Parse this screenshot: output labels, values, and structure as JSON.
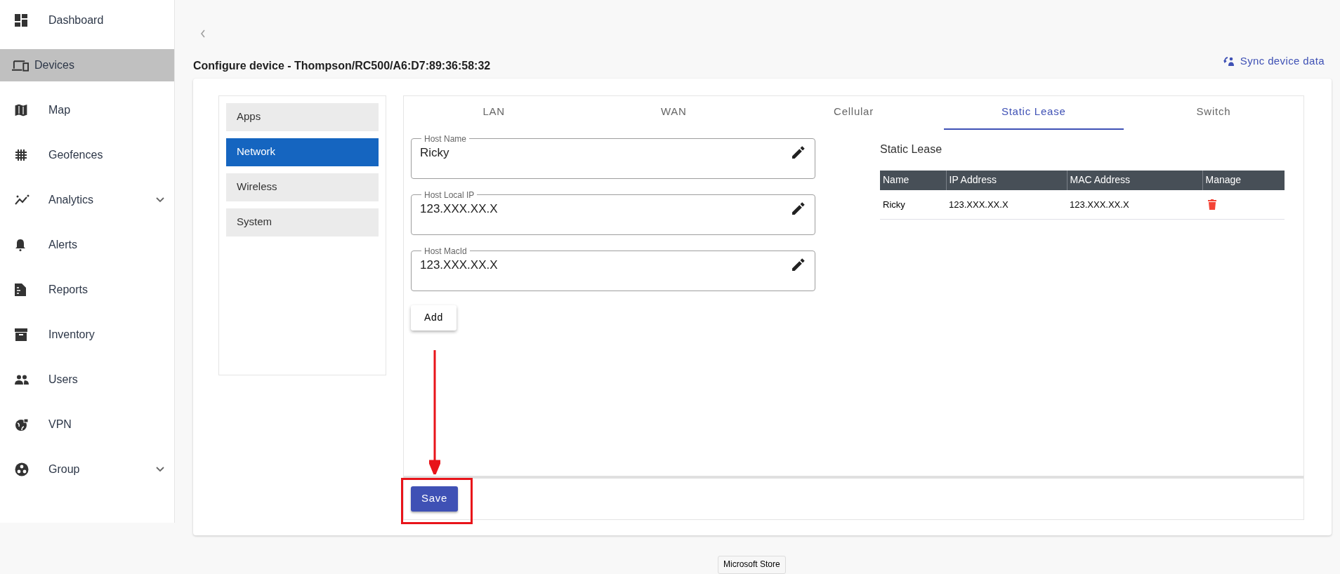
{
  "sidebar": {
    "items": [
      {
        "label": "Dashboard",
        "selected": false,
        "expandable": false
      },
      {
        "label": "Devices",
        "selected": true,
        "expandable": false
      },
      {
        "label": "Map",
        "selected": false,
        "expandable": false
      },
      {
        "label": "Geofences",
        "selected": false,
        "expandable": false
      },
      {
        "label": "Analytics",
        "selected": false,
        "expandable": true
      },
      {
        "label": "Alerts",
        "selected": false,
        "expandable": false
      },
      {
        "label": "Reports",
        "selected": false,
        "expandable": false
      },
      {
        "label": "Inventory",
        "selected": false,
        "expandable": false
      },
      {
        "label": "Users",
        "selected": false,
        "expandable": false
      },
      {
        "label": "VPN",
        "selected": false,
        "expandable": false
      },
      {
        "label": "Group",
        "selected": false,
        "expandable": true
      }
    ]
  },
  "page_title": "Configure device - Thompson/RC500/A6:D7:89:36:58:32",
  "sync_link": "Sync device data",
  "section_menu": [
    {
      "label": "Apps",
      "selected": false
    },
    {
      "label": "Network",
      "selected": true
    },
    {
      "label": "Wireless",
      "selected": false
    },
    {
      "label": "System",
      "selected": false
    }
  ],
  "tabs": [
    {
      "label": "LAN",
      "selected": false
    },
    {
      "label": "WAN",
      "selected": false
    },
    {
      "label": "Cellular",
      "selected": false
    },
    {
      "label": "Static Lease",
      "selected": true
    },
    {
      "label": "Switch",
      "selected": false
    }
  ],
  "form": {
    "fields": [
      {
        "label": "Host Name",
        "value": "Ricky"
      },
      {
        "label": "Host Local IP",
        "value": "123.XXX.XX.X"
      },
      {
        "label": "Host MacId",
        "value": "123.XXX.XX.X"
      }
    ],
    "add_button": "Add"
  },
  "static_lease": {
    "title": "Static Lease",
    "table": {
      "columns": [
        "Name",
        "IP Address",
        "MAC Address",
        "Manage"
      ],
      "rows": [
        {
          "cells": [
            "Ricky",
            "123.XXX.XX.X",
            "123.XXX.XX.X"
          ]
        }
      ]
    }
  },
  "save_button": "Save",
  "tooltip": "Microsoft Store"
}
